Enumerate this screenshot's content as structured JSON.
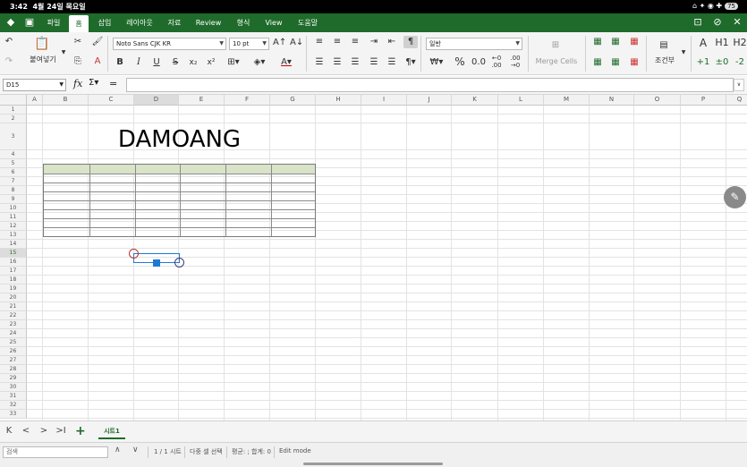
{
  "status": {
    "time": "3:42",
    "date": "4월 24일 목요일",
    "battery": "75"
  },
  "menu": {
    "tabs": [
      "파일",
      "홈",
      "삽입",
      "레이아웃",
      "자료",
      "Review",
      "형식",
      "View",
      "도움말"
    ],
    "active": "홈"
  },
  "ribbon": {
    "paste_label": "붙여넣기",
    "font_name": "Noto Sans CJK KR",
    "font_size": "10 pt",
    "number_format": "일반",
    "merge_label": "Merge Cells",
    "conditional_label": "조건부",
    "percent": "%",
    "comma": "0.0",
    "styles": [
      "A",
      "H1",
      "H2"
    ]
  },
  "formula": {
    "cell_ref": "D15",
    "fx": "fx",
    "sigma": "Σ",
    "equals": "=",
    "value": ""
  },
  "sheet": {
    "columns": [
      "A",
      "B",
      "C",
      "D",
      "E",
      "F",
      "G",
      "H",
      "I",
      "J",
      "K",
      "L",
      "M",
      "N",
      "O",
      "P",
      "Q"
    ],
    "rows": [
      "1",
      "2",
      "3",
      "4",
      "5",
      "6",
      "7",
      "8",
      "9",
      "10",
      "11",
      "12",
      "13",
      "14",
      "15",
      "16",
      "17",
      "18",
      "19",
      "20",
      "21",
      "22",
      "23",
      "24",
      "25",
      "26",
      "27",
      "28",
      "29",
      "30",
      "31",
      "32",
      "33"
    ],
    "selected_col": "D",
    "selected_row": "15",
    "title_text": "DAMOANG"
  },
  "sheetbar": {
    "first": "K",
    "prev": "<",
    "next": ">",
    "last": ">I",
    "add": "+",
    "tab_name": "시트1"
  },
  "bottom": {
    "search_placeholder": "검색",
    "up": "∧",
    "down": "∨",
    "sheet_count": "1 / 1 시트",
    "select_mode": "다중 셀 선택",
    "summary": "평균: ; 합계: 0",
    "mode": "Edit mode"
  },
  "colors": {
    "brand": "#1f6b2b",
    "header_fill": "#d9e3c8",
    "selection": "#1f7ad1"
  }
}
